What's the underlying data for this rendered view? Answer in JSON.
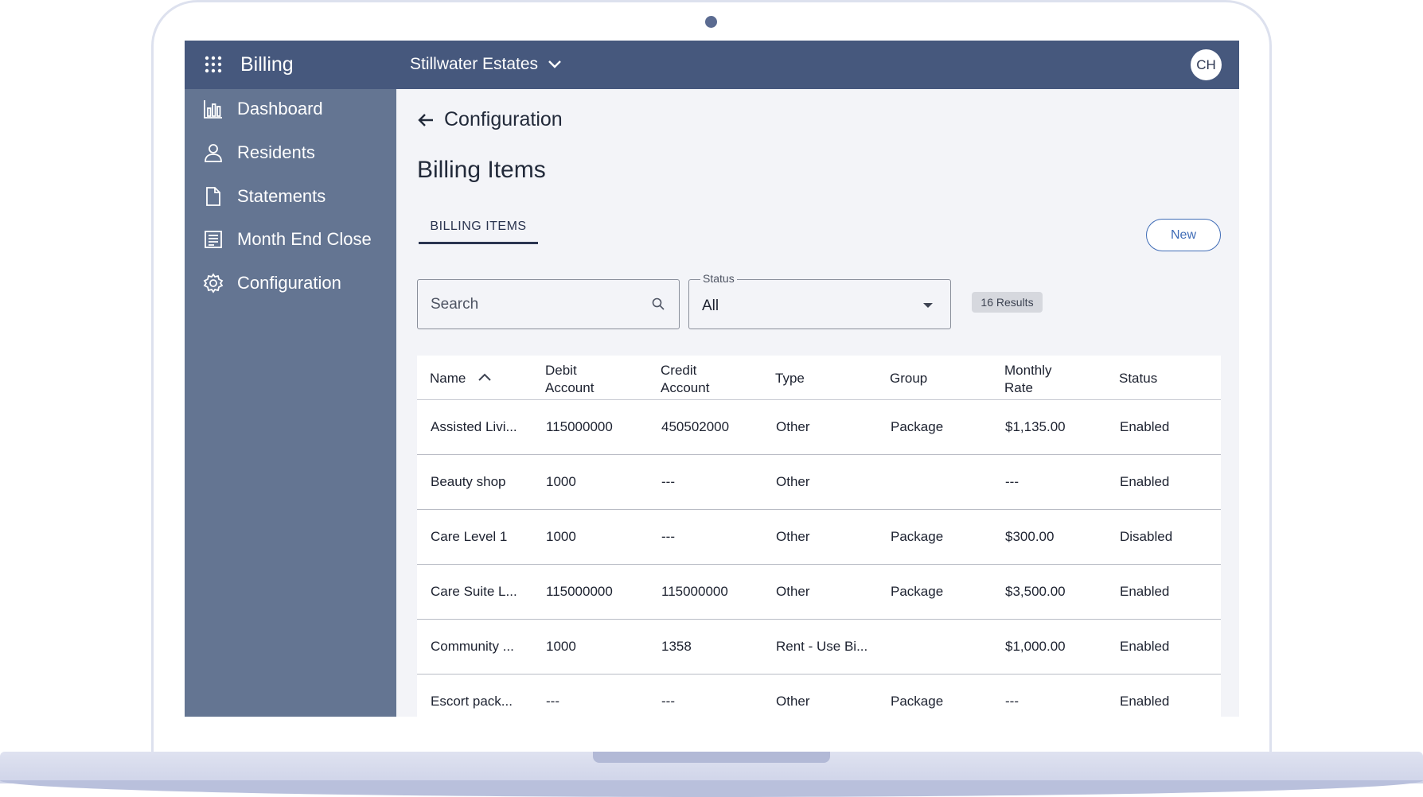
{
  "app": {
    "title": "Billing",
    "facility": "Stillwater Estates",
    "user_initials": "CH"
  },
  "sidebar": {
    "items": [
      {
        "label": "Dashboard",
        "icon": "bar-chart-icon"
      },
      {
        "label": "Residents",
        "icon": "person-icon"
      },
      {
        "label": "Statements",
        "icon": "document-icon"
      },
      {
        "label": "Month End Close",
        "icon": "ledger-icon"
      },
      {
        "label": "Configuration",
        "icon": "gear-icon"
      }
    ]
  },
  "main": {
    "back_label": "Configuration",
    "page_title": "Billing Items",
    "tab_label": "BILLING ITEMS",
    "new_button": "New",
    "search": {
      "placeholder": "Search",
      "value": ""
    },
    "status_filter": {
      "label": "Status",
      "value": "All"
    },
    "results_count": "16 Results"
  },
  "table": {
    "columns": [
      {
        "line1": "Name",
        "line2": "",
        "sorted": "asc"
      },
      {
        "line1": "Debit",
        "line2": "Account"
      },
      {
        "line1": "Credit",
        "line2": "Account"
      },
      {
        "line1": "Type",
        "line2": ""
      },
      {
        "line1": "Group",
        "line2": ""
      },
      {
        "line1": "Monthly",
        "line2": "Rate"
      },
      {
        "line1": "Status",
        "line2": ""
      }
    ],
    "rows": [
      [
        "Assisted Livi...",
        "115000000",
        "450502000",
        "Other",
        "Package",
        "$1,135.00",
        "Enabled"
      ],
      [
        "Beauty shop",
        "1000",
        "---",
        "Other",
        "",
        "---",
        "Enabled"
      ],
      [
        "Care Level 1",
        "1000",
        "---",
        "Other",
        "Package",
        "$300.00",
        "Disabled"
      ],
      [
        "Care Suite L...",
        "115000000",
        "115000000",
        "Other",
        "Package",
        "$3,500.00",
        "Enabled"
      ],
      [
        "Community ...",
        "1000",
        "1358",
        "Rent - Use Bi...",
        "",
        "$1,000.00",
        "Enabled"
      ],
      [
        "Escort pack...",
        "---",
        "---",
        "Other",
        "Package",
        "---",
        "Enabled"
      ]
    ]
  },
  "colors": {
    "topbar": "#46587d",
    "sidebar": "#647592",
    "accent": "#3f6cb6",
    "background": "#f3f4f8"
  }
}
